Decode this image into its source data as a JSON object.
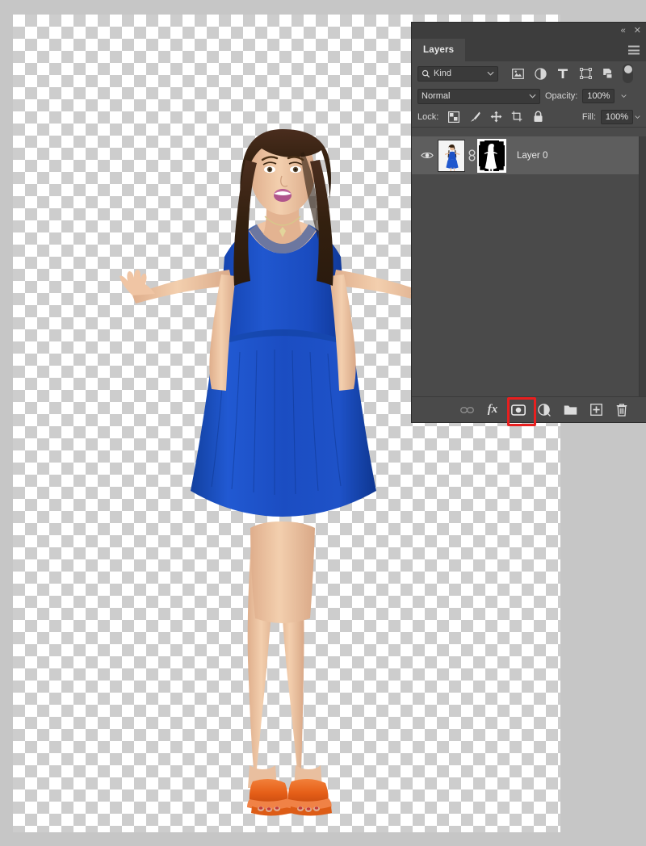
{
  "app": {
    "background_color": "#c6c6c6",
    "panel_bg": "#4a4a4a",
    "panel_header_bg": "#3d3d3d",
    "accent_highlight": "#e81f1f"
  },
  "canvas": {
    "name": "transparent-canvas",
    "checker_light": "#ffffff",
    "checker_dark": "#cdcdcd",
    "subject": {
      "description": "Woman in blue dress shrugging with hands raised, orange heeled sandals",
      "dress_color": "#1a4fc4",
      "skin_color": "#f0c9ab",
      "hair_color": "#3a2218",
      "shoe_color": "#ec6a1f"
    }
  },
  "panel": {
    "title": "Layers",
    "topbar": {
      "collapse_label": "«",
      "close_label": "✕"
    },
    "menu_label": "panel-menu",
    "filter": {
      "search_placeholder": "Kind",
      "kind_value": "Kind",
      "icons": [
        "pixel-layers-filter-icon",
        "adjustment-layers-filter-icon",
        "type-layers-filter-icon",
        "shape-layers-filter-icon",
        "smart-object-filter-icon"
      ],
      "toggle_name": "filter-enable-toggle"
    },
    "blend": {
      "mode": "Normal",
      "opacity_label": "Opacity:",
      "opacity_value": "100%"
    },
    "lock": {
      "label": "Lock:",
      "fill_label": "Fill:",
      "fill_value": "100%",
      "icons": [
        "lock-transparent-pixels-icon",
        "lock-image-pixels-icon",
        "lock-position-icon",
        "lock-artboard-nesting-icon",
        "lock-all-icon"
      ]
    },
    "layers": [
      {
        "name": "Layer 0",
        "visible": true,
        "linked": true,
        "has_mask": true,
        "mask_selected": true
      }
    ],
    "bottom_toolbar": [
      {
        "name": "link-layers-button",
        "label": "Link layers",
        "enabled": false
      },
      {
        "name": "layer-style-fx-button",
        "label": "fx",
        "enabled": true
      },
      {
        "name": "add-layer-mask-button",
        "label": "Add layer mask",
        "enabled": true,
        "highlighted": true
      },
      {
        "name": "new-adjustment-layer-button",
        "label": "Create new fill or adjustment layer",
        "enabled": true
      },
      {
        "name": "new-group-button",
        "label": "Create a new group",
        "enabled": true
      },
      {
        "name": "new-layer-button",
        "label": "Create a new layer",
        "enabled": true
      },
      {
        "name": "delete-layer-button",
        "label": "Delete layer",
        "enabled": true
      }
    ]
  }
}
